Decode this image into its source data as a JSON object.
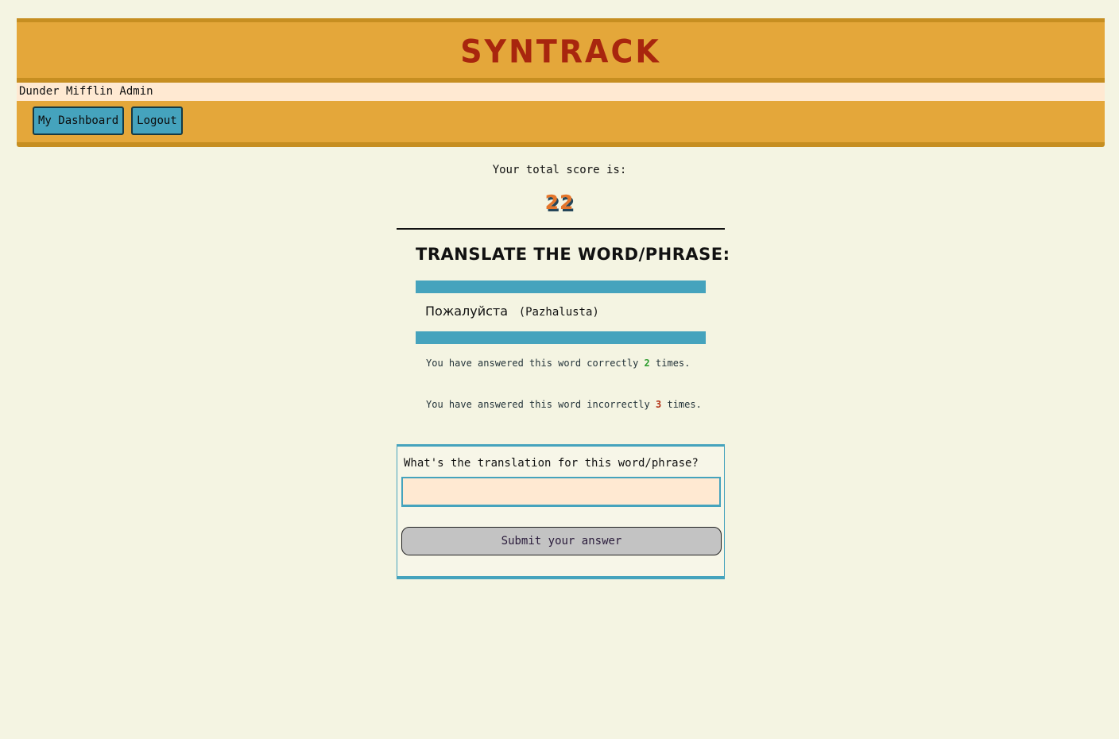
{
  "app": {
    "brand": "SYNTRACK"
  },
  "user": {
    "name": "Dunder Mifflin Admin"
  },
  "nav": {
    "dashboard_label": "My Dashboard",
    "logout_label": "Logout"
  },
  "score": {
    "label": "Your total score is:",
    "value": "22"
  },
  "quiz": {
    "title": "Translate the word/phrase:",
    "word": "Пожалуйста",
    "transliteration": "(Pazhalusta)",
    "correct_prefix": "You have answered this word correctly",
    "correct_count": "2",
    "correct_suffix": "times.",
    "incorrect_prefix": "You have answered this word incorrectly",
    "incorrect_count": "3",
    "incorrect_suffix": "times."
  },
  "form": {
    "label": "What's the translation for this word/phrase?",
    "input_value": "",
    "submit_label": "Submit your answer"
  },
  "colors": {
    "background": "#f4f4e2",
    "header": "#e4a73a",
    "header_border": "#c68e21",
    "brand": "#a8260e",
    "accent": "#45a3bd",
    "userbar": "#ffe9d2",
    "correct": "#2e9c2e",
    "incorrect": "#b33216",
    "score": "#e4762c"
  }
}
